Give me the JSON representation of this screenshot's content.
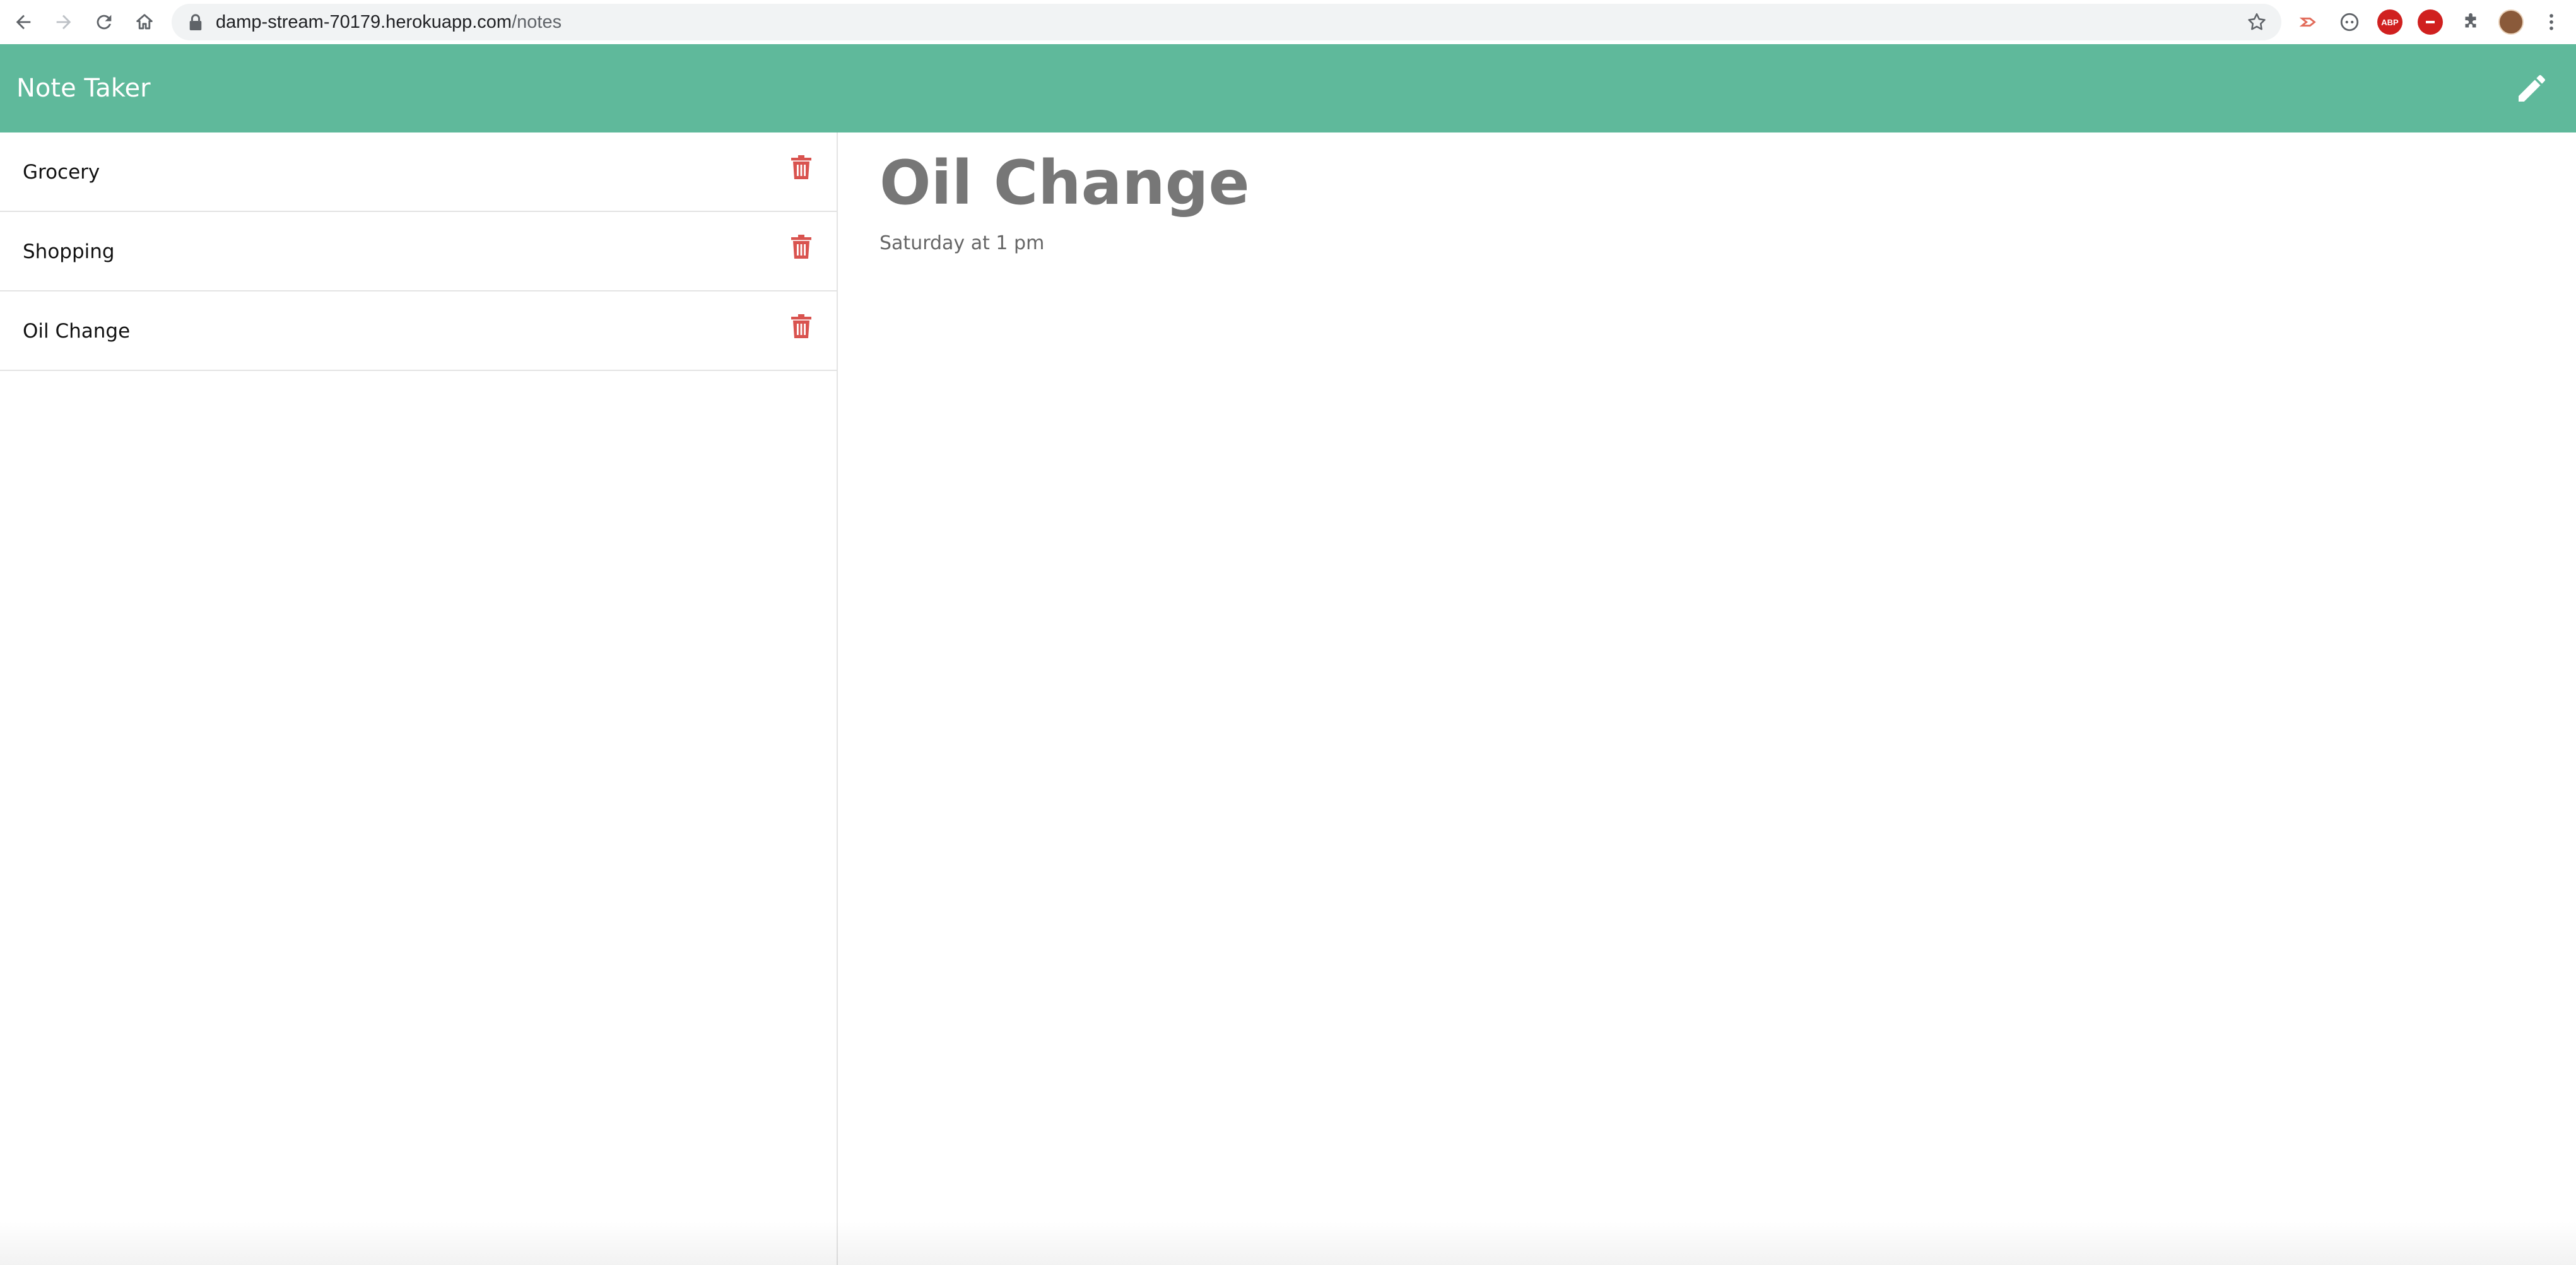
{
  "browser": {
    "url_host": "damp-stream-70179.herokuapp.com",
    "url_path": "/notes",
    "icons": [
      "back-arrow-icon",
      "forward-arrow-icon",
      "reload-icon",
      "home-icon",
      "lock-icon",
      "star-icon",
      "extensions-puzzle-icon",
      "menu-dots-icon"
    ],
    "extensions": {
      "abp_label": "ABP"
    }
  },
  "app": {
    "brand": "Note Taker",
    "accent_color": "#5fb99b",
    "delete_color": "#d9534f"
  },
  "notes": [
    {
      "title": "Grocery"
    },
    {
      "title": "Shopping"
    },
    {
      "title": "Oil Change"
    }
  ],
  "active_note": {
    "title": "Oil Change",
    "text": "Saturday at 1 pm"
  }
}
